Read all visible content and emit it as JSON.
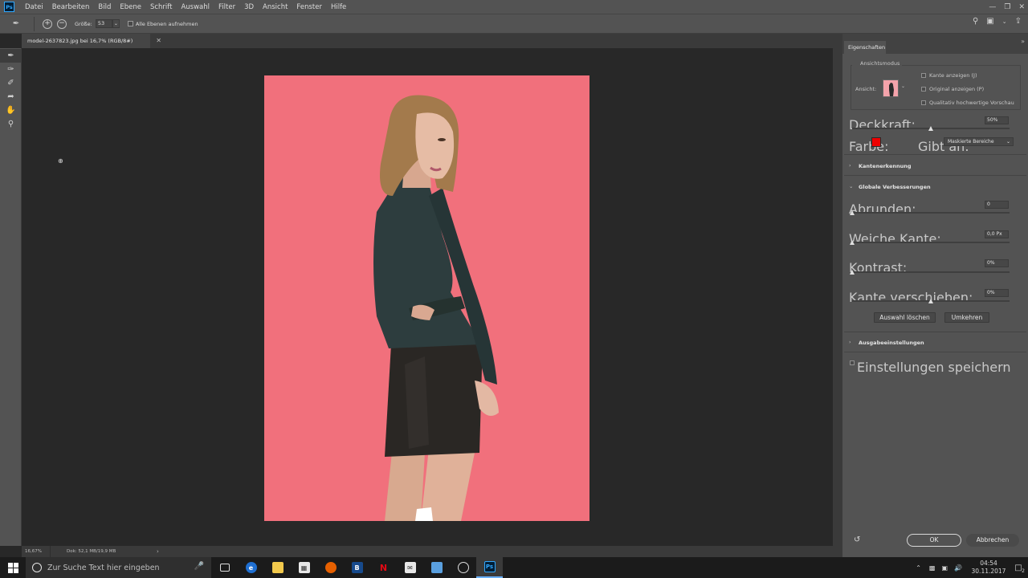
{
  "app": {
    "logo": "Ps",
    "menu": [
      "Datei",
      "Bearbeiten",
      "Bild",
      "Ebene",
      "Schrift",
      "Auswahl",
      "Filter",
      "3D",
      "Ansicht",
      "Fenster",
      "Hilfe"
    ]
  },
  "options": {
    "size_label": "Größe:",
    "size_value": "53",
    "sample_all_label": "Alle Ebenen aufnehmen"
  },
  "document": {
    "tab_title": "model-2637823.jpg bei 16,7% (RGB/8#)",
    "overlay_color": "#f1707c"
  },
  "status": {
    "zoom": "16,67%",
    "doc_size": "Dok: 52,1 MB/19,9 MB"
  },
  "properties": {
    "panel_title": "Eigenschaften",
    "view_mode": {
      "legend": "Ansichtsmodus",
      "view_label": "Ansicht:",
      "show_edge": "Kante anzeigen (J)",
      "show_original": "Original anzeigen (P)",
      "hq_preview": "Qualitativ hochwertige Vorschau"
    },
    "opacity": {
      "label": "Deckkraft:",
      "value": "50%",
      "level": 0.5
    },
    "color": {
      "label": "Farbe:",
      "value": "#ee0000",
      "indicates_label": "Gibt an:",
      "indicates_value": "Maskierte Bereiche"
    },
    "edge_detection": {
      "title": "Kantenerkennung"
    },
    "global_refinements": {
      "title": "Globale Verbesserungen",
      "smooth": {
        "label": "Abrunden:",
        "value": "0",
        "level": 0
      },
      "feather": {
        "label": "Weiche Kante:",
        "value": "0,0 Px",
        "level": 0
      },
      "contrast": {
        "label": "Kontrast:",
        "value": "0%",
        "level": 0
      },
      "shift_edge": {
        "label": "Kante verschieben:",
        "value": "0%",
        "level": 0.5
      },
      "clear_selection": "Auswahl löschen",
      "invert": "Umkehren"
    },
    "output": {
      "title": "Ausgabeeinstellungen"
    },
    "remember_label": "Einstellungen speichern",
    "ok": "OK",
    "cancel": "Abbrechen"
  },
  "taskbar": {
    "search_placeholder": "Zur Suche Text hier eingeben",
    "time": "04:54",
    "date": "30.11.2017",
    "notification_count": "2"
  }
}
